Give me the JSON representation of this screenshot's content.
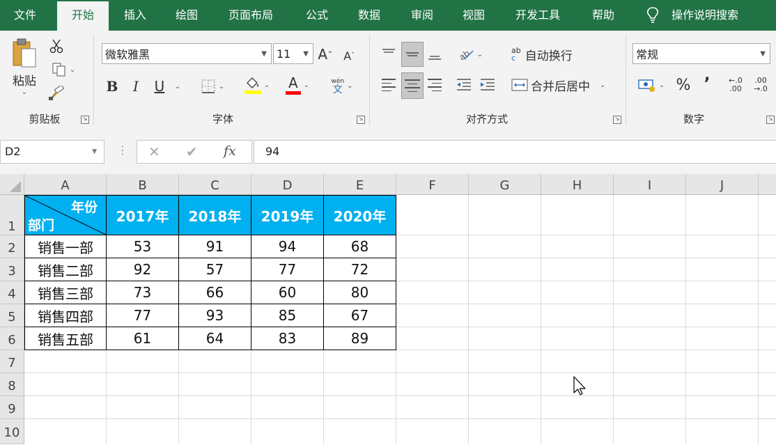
{
  "ribbon_tabs": [
    "文件",
    "开始",
    "插入",
    "绘图",
    "页面布局",
    "公式",
    "数据",
    "审阅",
    "视图",
    "开发工具",
    "帮助"
  ],
  "active_tab": "开始",
  "tell_me": "操作说明搜索",
  "clipboard": {
    "paste_label": "粘贴",
    "group_label": "剪贴板"
  },
  "font": {
    "name": "微软雅黑",
    "size": "11",
    "group_label": "字体",
    "bold": "B",
    "italic": "I",
    "underline": "U",
    "phonetic_top": "wén",
    "phonetic_bottom": "文",
    "grow": "A",
    "shrink": "A",
    "font_color_letter": "A",
    "fill_color": "#ffff00",
    "text_color": "#ff0000"
  },
  "alignment": {
    "wrap_label": "自动换行",
    "merge_label": "合并后居中",
    "group_label": "对齐方式",
    "wrap_icon_top": "ab",
    "wrap_icon_bottom": "c"
  },
  "number": {
    "format": "常规",
    "group_label": "数字",
    "percent": "%",
    "comma": "’",
    "inc_top": "←.0",
    "inc_bottom": ".00",
    "dec_top": ".00",
    "dec_bottom": "→.0"
  },
  "formula_bar": {
    "name_box": "D2",
    "value": "94",
    "cancel": "✕",
    "enter": "✔",
    "fx": "fx"
  },
  "columns": [
    "A",
    "B",
    "C",
    "D",
    "E",
    "F",
    "G",
    "H",
    "I",
    "J"
  ],
  "rows": [
    "1",
    "2",
    "3",
    "4",
    "5",
    "6",
    "7",
    "8",
    "9",
    "10"
  ],
  "table": {
    "corner_top": "年份",
    "corner_bottom": "部门",
    "years": [
      "2017年",
      "2018年",
      "2019年",
      "2020年"
    ],
    "rows": [
      {
        "dept": "销售一部",
        "values": [
          "53",
          "91",
          "94",
          "68"
        ]
      },
      {
        "dept": "销售二部",
        "values": [
          "92",
          "57",
          "77",
          "72"
        ]
      },
      {
        "dept": "销售三部",
        "values": [
          "73",
          "66",
          "60",
          "80"
        ]
      },
      {
        "dept": "销售四部",
        "values": [
          "77",
          "93",
          "85",
          "67"
        ]
      },
      {
        "dept": "销售五部",
        "values": [
          "61",
          "64",
          "83",
          "89"
        ]
      }
    ],
    "header_color": "#00b0f0"
  },
  "colors": {
    "ribbon_green": "#217346"
  }
}
